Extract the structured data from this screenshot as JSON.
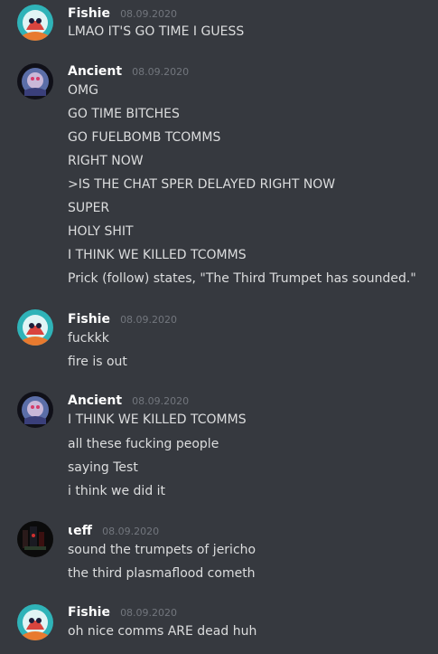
{
  "messages": [
    {
      "author": "Fishie",
      "timestamp": "08.09.2020",
      "avatar_icon": "fishie-avatar-icon",
      "lines": [
        "LMAO IT'S GO TIME I GUESS"
      ]
    },
    {
      "author": "Ancient",
      "timestamp": "08.09.2020",
      "avatar_icon": "ancient-avatar-icon",
      "lines": [
        "OMG",
        "GO TIME BITCHES",
        "GO FUELBOMB TCOMMS",
        "RIGHT NOW",
        ">IS THE CHAT SPER DELAYED RIGHT NOW",
        "SUPER",
        "HOLY SHIT",
        "I THINK WE KILLED TCOMMS",
        "Prick (follow) states, \"The Third Trumpet has sounded.\""
      ]
    },
    {
      "author": "Fishie",
      "timestamp": "08.09.2020",
      "avatar_icon": "fishie-avatar-icon",
      "lines": [
        "fuckkk",
        "fire is out"
      ]
    },
    {
      "author": "Ancient",
      "timestamp": "08.09.2020",
      "avatar_icon": "ancient-avatar-icon",
      "lines": [
        "I THINK WE KILLED TCOMMS",
        "all these fucking people",
        "saying Test",
        "i think we did it"
      ]
    },
    {
      "author": "ɩeff",
      "timestamp": "08.09.2020",
      "avatar_icon": "jeff-avatar-icon",
      "lines": [
        "sound the trumpets of jericho",
        "the third plasmaflood cometh"
      ]
    },
    {
      "author": "Fishie",
      "timestamp": "08.09.2020",
      "avatar_icon": "fishie-avatar-icon",
      "lines": [
        "oh nice comms ARE dead huh"
      ]
    }
  ],
  "colors": {
    "background": "#36393f",
    "username": "#ffffff",
    "timestamp": "#72767d",
    "text": "#dcddde"
  }
}
